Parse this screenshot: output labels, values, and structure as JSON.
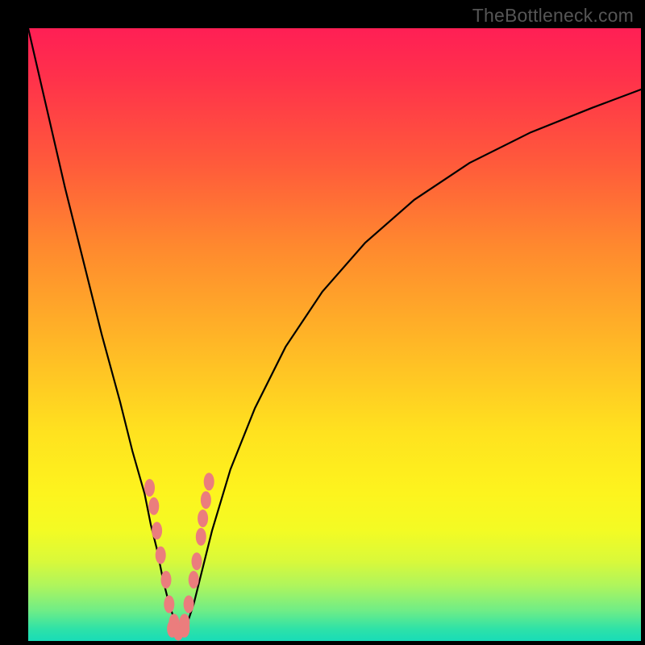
{
  "watermark": "TheBottleneck.com",
  "colors": {
    "frame_bg": "#000000",
    "gradient_top": "#ff1f55",
    "gradient_mid": "#ffe21f",
    "gradient_bottom": "#18dcb8",
    "curve_stroke": "#000000",
    "bead_fill": "#eb7d7d"
  },
  "chart_data": {
    "type": "line",
    "title": "",
    "xlabel": "",
    "ylabel": "",
    "xlim": [
      0,
      100
    ],
    "ylim": [
      0,
      100
    ],
    "grid": false,
    "series": [
      {
        "name": "bottleneck-curve",
        "x": [
          0,
          3,
          6,
          9,
          12,
          15,
          17,
          19,
          20,
          21,
          22,
          23,
          24,
          25,
          26,
          27,
          28,
          30,
          33,
          37,
          42,
          48,
          55,
          63,
          72,
          82,
          92,
          100
        ],
        "values": [
          100,
          87,
          74,
          62,
          50,
          39,
          31,
          24,
          19,
          15,
          10,
          6,
          3,
          2,
          3,
          6,
          10,
          18,
          28,
          38,
          48,
          57,
          65,
          72,
          78,
          83,
          87,
          90
        ]
      }
    ],
    "annotations": {
      "beads_left": [
        {
          "x": 19.8,
          "y": 25
        },
        {
          "x": 20.5,
          "y": 22
        },
        {
          "x": 21.0,
          "y": 18
        },
        {
          "x": 21.6,
          "y": 14
        },
        {
          "x": 22.5,
          "y": 10
        },
        {
          "x": 23.0,
          "y": 6
        },
        {
          "x": 23.8,
          "y": 3
        }
      ],
      "beads_right": [
        {
          "x": 25.5,
          "y": 3
        },
        {
          "x": 26.2,
          "y": 6
        },
        {
          "x": 27.0,
          "y": 10
        },
        {
          "x": 27.5,
          "y": 13
        },
        {
          "x": 28.2,
          "y": 17
        },
        {
          "x": 28.5,
          "y": 20
        },
        {
          "x": 29.0,
          "y": 23
        },
        {
          "x": 29.5,
          "y": 26
        }
      ],
      "beads_bottom": [
        {
          "x": 23.5,
          "y": 2
        },
        {
          "x": 24.5,
          "y": 1.5
        },
        {
          "x": 25.5,
          "y": 2
        }
      ]
    }
  }
}
